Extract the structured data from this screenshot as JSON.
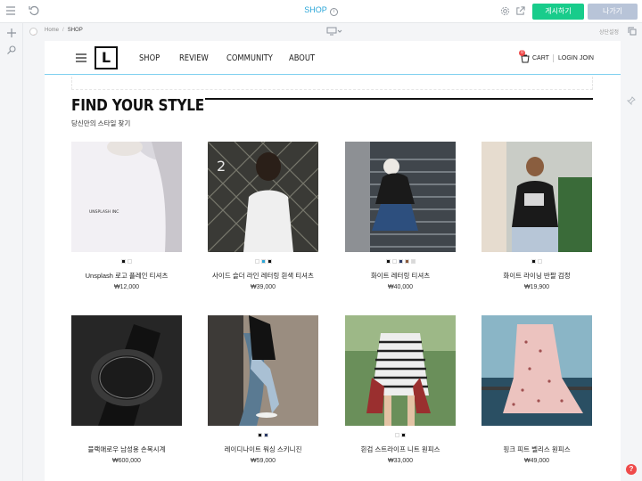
{
  "editor": {
    "page_name": "SHOP",
    "info_glyph": "i",
    "publish_label": "게시하기",
    "exit_label": "나가기",
    "breadcrumb": [
      "Home",
      "SHOP"
    ],
    "top_setting_label": "상단설정",
    "help_glyph": "?",
    "accent": "#18cc8b"
  },
  "site": {
    "logo_letter": "L",
    "nav": [
      "SHOP",
      "REVIEW",
      "COMMUNITY",
      "ABOUT"
    ],
    "cart_label": "CART",
    "cart_count": "0",
    "login_label": "LOGIN",
    "join_label": "JOIN"
  },
  "section": {
    "title": "FIND YOUR STYLE",
    "subtitle": "당신만의 스타일 찾기"
  },
  "products": [
    {
      "name": "Unsplash 로고 플레인 티셔츠",
      "price": "₩12,000",
      "swatches": [
        "#111111",
        "#ffffff"
      ],
      "img": "white-tshirt"
    },
    {
      "name": "사이드 슬더 라인 레터링 흰색 티셔츠",
      "price": "₩39,000",
      "swatches": [
        "#ffffff",
        "#2aa6d8",
        "#111111"
      ],
      "img": "man-fence"
    },
    {
      "name": "화이트 레터링 티셔츠",
      "price": "₩40,000",
      "swatches": [
        "#111111",
        "#ffffff",
        "#2b3a67",
        "#8a5a3c",
        "#d9d9d9"
      ],
      "img": "man-stairs"
    },
    {
      "name": "화이트 라이닝 반팔 검정",
      "price": "₩19,900",
      "swatches": [
        "#111111",
        "#ffffff"
      ],
      "img": "man-sunglasses"
    },
    {
      "name": "블랙애로우 남성용 손목시계",
      "price": "₩600,000",
      "swatches": [],
      "img": "watch"
    },
    {
      "name": "레이디나이트 워싱 스키니진",
      "price": "₩59,000",
      "swatches": [
        "#111111",
        "#2b3a67"
      ],
      "img": "woman-jeans"
    },
    {
      "name": "흰검 스트라이프 니트 원피스",
      "price": "₩33,000",
      "swatches": [
        "#ffffff",
        "#111111"
      ],
      "img": "woman-stripe"
    },
    {
      "name": "핑크 피트 벨리스 원피스",
      "price": "₩49,000",
      "swatches": [],
      "img": "pink-dress"
    }
  ]
}
